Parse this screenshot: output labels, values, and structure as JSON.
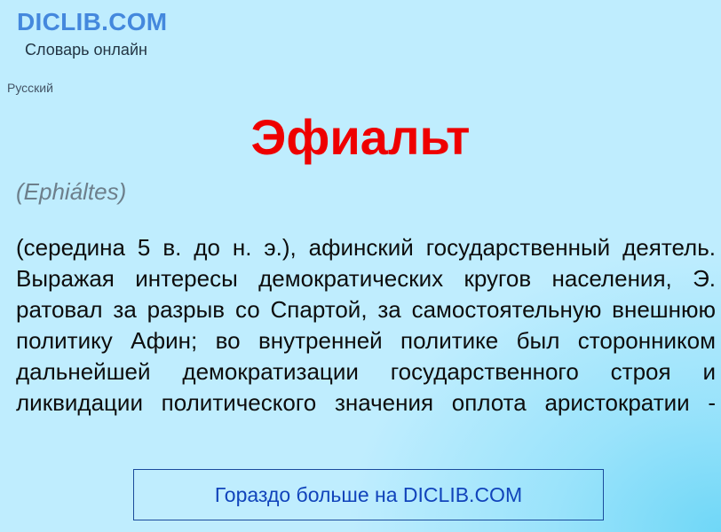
{
  "site": {
    "logo": "DICLIB.COM",
    "tagline": "Словарь онлайн",
    "language": "Русский"
  },
  "entry": {
    "headword": "Эфиальт",
    "transcription": "(Ephiáltes)",
    "definition": "(середина 5 в. до н. э.), афинский государственный деятель. Выражая интересы демократических кругов населения, Э. ратовал за разрыв со Спартой, за самостоятельную внешнюю политику Афин; во внутренней политике был сторонником дальнейшей демократизации государственного строя и ликвидации политического значения оплота аристократии -"
  },
  "more_link": {
    "label": "Гораздо больше на DICLIB.COM"
  },
  "colors": {
    "logo": "#4488dd",
    "headword": "#ee0000",
    "link": "#1144bb",
    "background": "#bfedfe",
    "background_accent": "#6fd7f7"
  }
}
